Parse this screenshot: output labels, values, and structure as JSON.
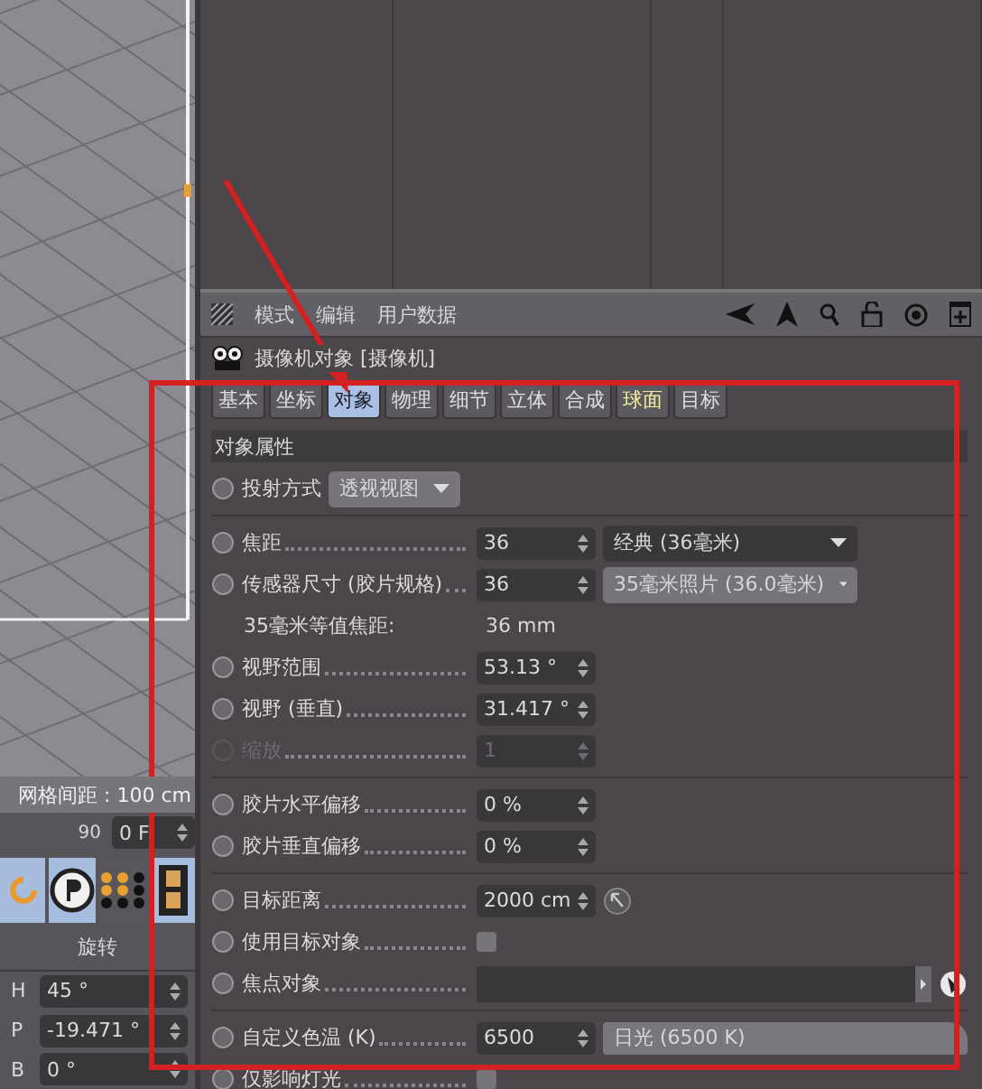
{
  "viewport": {
    "grid_label": "网格间距 : 100 cm"
  },
  "timeline": {
    "frame_tick": "90",
    "current_frame": "0 F"
  },
  "coords": {
    "header": "旋转",
    "fields": [
      {
        "axis": "H",
        "value": "45 °"
      },
      {
        "axis": "P",
        "value": "-19.471 °"
      },
      {
        "axis": "B",
        "value": "0 °"
      }
    ]
  },
  "menu": [
    "模式",
    "编辑",
    "用户数据"
  ],
  "object_title": "摄像机对象 [摄像机]",
  "tabs": [
    {
      "label": "基本",
      "selected": false,
      "highlighted": false
    },
    {
      "label": "坐标",
      "selected": false,
      "highlighted": false
    },
    {
      "label": "对象",
      "selected": true,
      "highlighted": false
    },
    {
      "label": "物理",
      "selected": false,
      "highlighted": false
    },
    {
      "label": "细节",
      "selected": false,
      "highlighted": false
    },
    {
      "label": "立体",
      "selected": false,
      "highlighted": false
    },
    {
      "label": "合成",
      "selected": false,
      "highlighted": false
    },
    {
      "label": "球面",
      "selected": false,
      "highlighted": true
    },
    {
      "label": "目标",
      "selected": false,
      "highlighted": false
    }
  ],
  "section": "对象属性",
  "groups": [
    [
      {
        "kind": "select",
        "label": "投射方式",
        "value": "透视视图"
      }
    ],
    [
      {
        "kind": "number",
        "label": "焦距",
        "value": "36",
        "dropdown": "经典 (36毫米)",
        "disabled": false
      },
      {
        "kind": "number",
        "label": "传感器尺寸 (胶片规格)",
        "value": "36",
        "dropdown": "35毫米照片 (36.0毫米)",
        "disabled": false
      },
      {
        "kind": "info",
        "label": "35毫米等值焦距:",
        "value": "36 mm"
      },
      {
        "kind": "number",
        "label": "视野范围",
        "value": "53.13 °",
        "disabled": false
      },
      {
        "kind": "number",
        "label": "视野 (垂直)",
        "value": "31.417 °",
        "disabled": false
      },
      {
        "kind": "number",
        "label": "缩放",
        "value": "1",
        "disabled": true
      }
    ],
    [
      {
        "kind": "number",
        "label": "胶片水平偏移",
        "value": "0 %",
        "disabled": false
      },
      {
        "kind": "number",
        "label": "胶片垂直偏移",
        "value": "0 %",
        "disabled": false
      }
    ],
    [
      {
        "kind": "number",
        "label": "目标距离",
        "value": "2000 cm",
        "picker": true,
        "disabled": false
      },
      {
        "kind": "checkbox",
        "label": "使用目标对象",
        "checked": false
      },
      {
        "kind": "link",
        "label": "焦点对象"
      }
    ],
    [
      {
        "kind": "number",
        "label": "自定义色温 (K)",
        "value": "6500",
        "preset": "日光 (6500 K)",
        "disabled": false
      },
      {
        "kind": "checkbox",
        "label": "仅影响灯光",
        "checked": false
      }
    ]
  ]
}
